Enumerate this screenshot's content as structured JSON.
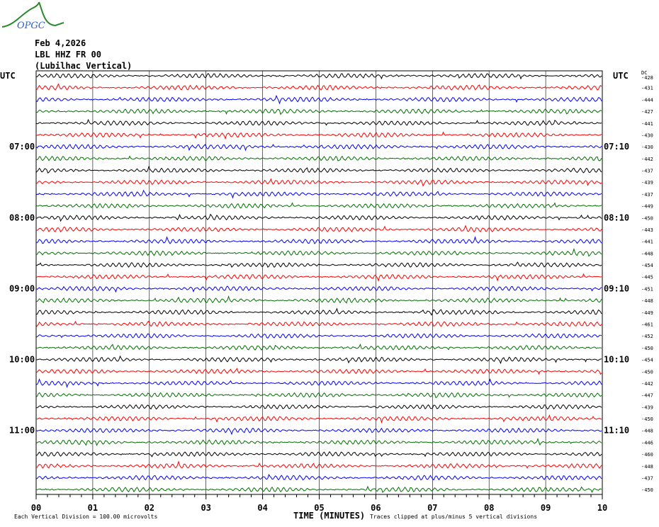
{
  "header": {
    "date": "Feb 4,2026",
    "station": "LBL HHZ FR 00",
    "location": "(Lubilhac Vertical)",
    "logo_text": "OPGC"
  },
  "footer": {
    "scale": "Each Vertical Division =  100.00 microvolts",
    "xlabel": "TIME (MINUTES)",
    "clip_note": "Traces clipped at plus/minus 5 vertical divisions"
  },
  "chart_data": {
    "type": "line",
    "title": "",
    "xlabel": "TIME (MINUTES)",
    "xlim": [
      0,
      10
    ],
    "x_ticks": [
      "00",
      "01",
      "02",
      "03",
      "04",
      "05",
      "06",
      "07",
      "08",
      "09",
      "10"
    ],
    "left_axis_title": "UTC",
    "right_axis_title": "UTC",
    "dc_header": "DC",
    "left_labels": [
      {
        "row": 6,
        "text": "07:00"
      },
      {
        "row": 12,
        "text": "08:00"
      },
      {
        "row": 18,
        "text": "09:00"
      },
      {
        "row": 24,
        "text": "10:00"
      },
      {
        "row": 30,
        "text": "11:00"
      }
    ],
    "right_labels": [
      {
        "row": 6,
        "text": "07:10"
      },
      {
        "row": 12,
        "text": "08:10"
      },
      {
        "row": 18,
        "text": "09:10"
      },
      {
        "row": 24,
        "text": "10:10"
      },
      {
        "row": 30,
        "text": "11:10"
      }
    ],
    "trace_colors": [
      "#000000",
      "#ff0000",
      "#0000ff",
      "#007000"
    ],
    "dc_offsets": [
      -428,
      -431,
      -444,
      -427,
      -441,
      -430,
      -430,
      -442,
      -437,
      -439,
      -437,
      -449,
      -450,
      -443,
      -441,
      -448,
      -454,
      -445,
      -451,
      -448,
      -449,
      -461,
      -452,
      -450,
      -454,
      -450,
      -442,
      -447,
      -439,
      -450,
      -448,
      -446,
      -460,
      -448,
      -437,
      -450
    ]
  }
}
